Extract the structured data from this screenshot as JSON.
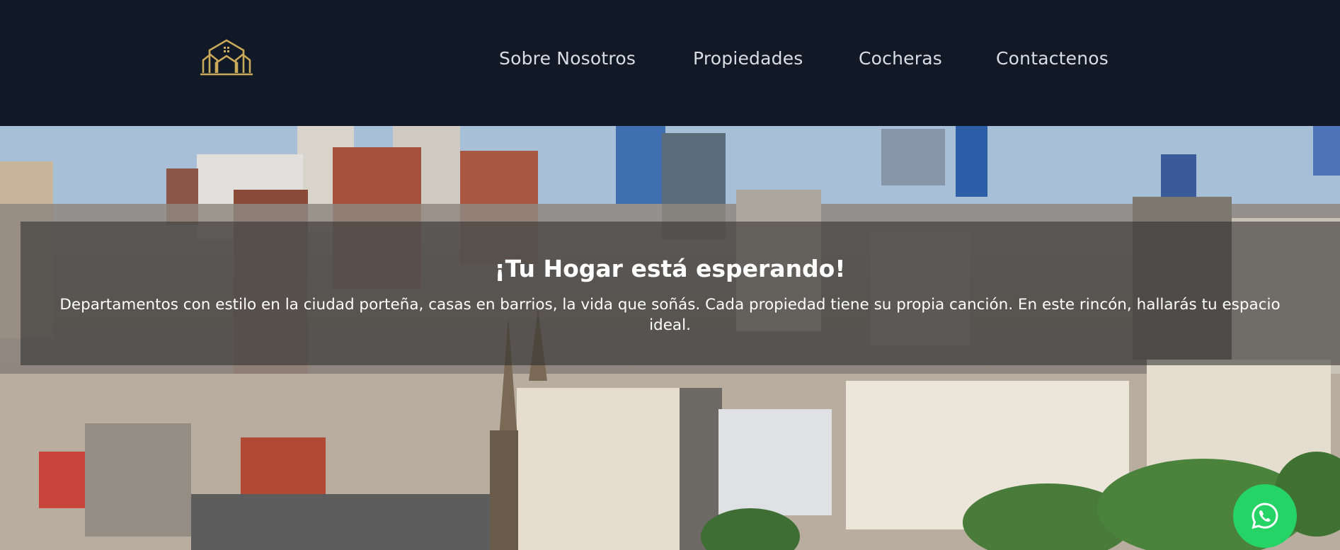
{
  "brand": {
    "logo_icon": "house-outline-logo",
    "accent_color": "#c9a95a"
  },
  "nav": {
    "items": [
      {
        "label": "Sobre Nosotros"
      },
      {
        "label": "Propiedades"
      },
      {
        "label": "Cocheras"
      },
      {
        "label": "Contactenos"
      }
    ]
  },
  "hero": {
    "title": "¡Tu Hogar está esperando!",
    "text": "Departamentos con estilo en la ciudad porteña, casas en barrios, la vida que soñás. Cada propiedad tiene su propia canción. En este rincón, hallarás tu espacio ideal.",
    "background_image": "buenos-aires-city-skyline"
  },
  "whatsapp": {
    "icon": "whatsapp-icon",
    "color": "#25d366"
  }
}
